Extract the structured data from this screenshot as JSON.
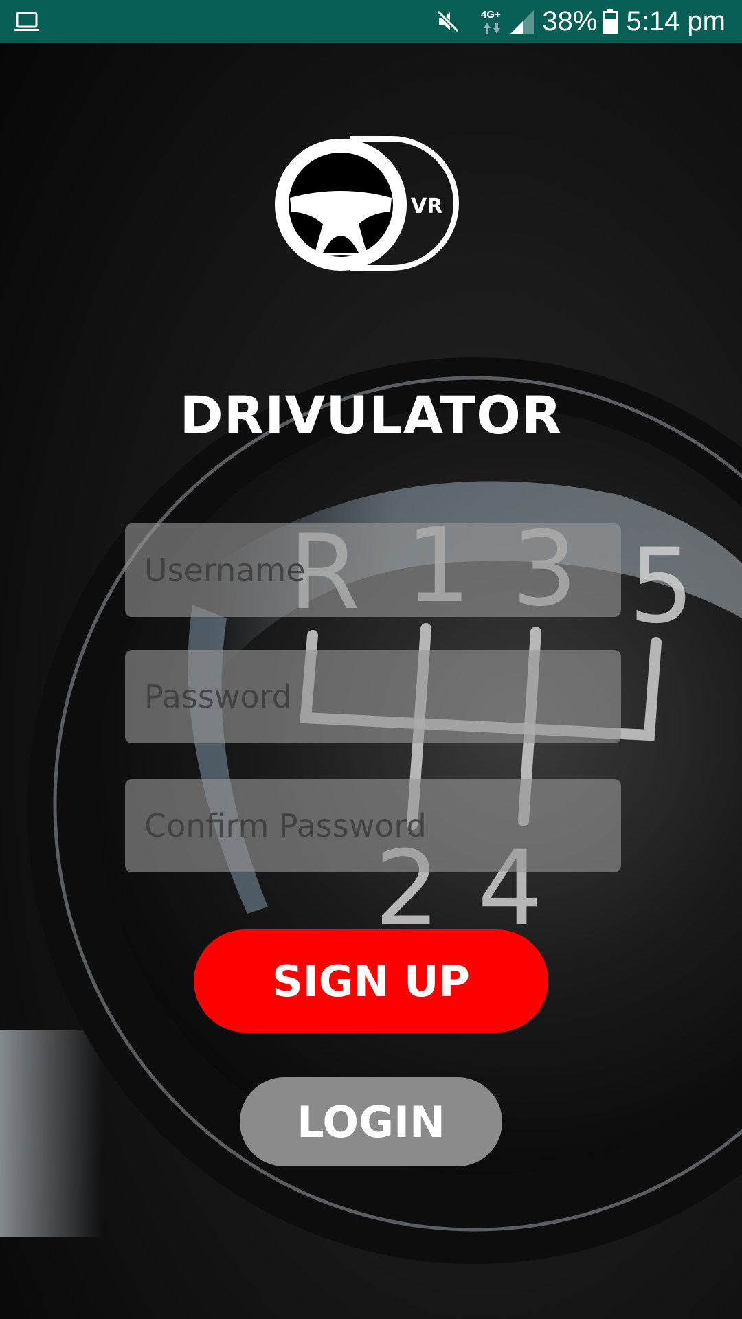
{
  "status_bar": {
    "network": "4G+",
    "battery": "38%",
    "time": "5:14 pm",
    "icons": [
      "laptop-icon",
      "mute-icon",
      "network-data-icon",
      "signal-icon",
      "battery-icon"
    ]
  },
  "app": {
    "title": "DRIVULATOR",
    "logo_text": "VR"
  },
  "form": {
    "username_placeholder": "Username",
    "password_placeholder": "Password",
    "confirm_password_placeholder": "Confirm Password"
  },
  "buttons": {
    "signup_label": "SIGN UP",
    "login_label": "LOGIN"
  },
  "background": {
    "shifter_labels": [
      "R",
      "1",
      "3",
      "5",
      "2",
      "4"
    ]
  },
  "colors": {
    "status_bar": "#075e54",
    "signup_button": "#ff0000",
    "login_button": "#8b8b8b",
    "title_text": "#ffffff"
  }
}
